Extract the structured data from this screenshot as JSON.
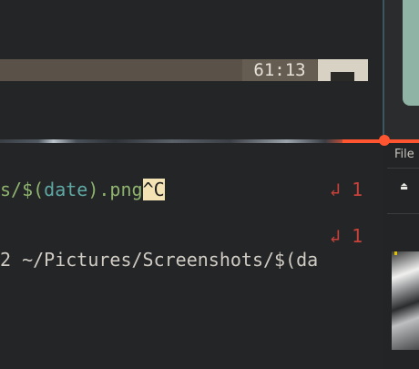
{
  "terminal": {
    "status": {
      "position": "61:13"
    },
    "lines": [
      {
        "segments": [
          {
            "text": "s/$(",
            "style": "green"
          },
          {
            "text": "date",
            "style": "teal"
          },
          {
            "text": ").png",
            "style": "green"
          },
          {
            "text": "^C",
            "style": "hl"
          }
        ],
        "retcode": "↲ 1"
      },
      {
        "retcode": "↲ 1"
      },
      {
        "text": "2 ~/Pictures/Screenshots/$(da"
      }
    ]
  },
  "side_panel": {
    "menu_label": "File",
    "icon": "screenshot-icon",
    "accent_color": "#ff5530"
  }
}
